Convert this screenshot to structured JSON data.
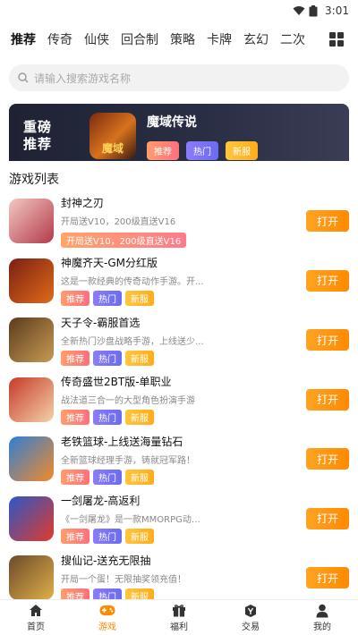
{
  "status": {
    "time": "3:01"
  },
  "tabs": [
    "推荐",
    "传奇",
    "仙侠",
    "回合制",
    "策略",
    "卡牌",
    "玄幻",
    "二次"
  ],
  "search": {
    "placeholder": "请输入搜索游戏名称"
  },
  "banner": {
    "tagline": "重磅\n推荐",
    "game_name": "魔域传说",
    "icon_text": "魔域",
    "badges": [
      "推荐",
      "热门",
      "新服"
    ]
  },
  "list": {
    "title": "游戏列表",
    "open_label": "打开",
    "games": [
      {
        "name": "封神之刃",
        "desc": "开局送V10，200级直送V16",
        "promo": "开局送V10，200级直送V16",
        "badges": [],
        "color1": "#f3c8c2",
        "color2": "#b23a48"
      },
      {
        "name": "神魔齐天-GM分红版",
        "desc": "这是一款经典的传奇动作手游。开...",
        "badges": [
          "推荐",
          "热门",
          "新服"
        ],
        "color1": "#7a1f12",
        "color2": "#e06a1a"
      },
      {
        "name": "天子令-霸服首选",
        "desc": "全新热门沙盘战略手游，上线送少...",
        "badges": [
          "推荐",
          "热门",
          "新服"
        ],
        "color1": "#5a3b1e",
        "color2": "#c89a52"
      },
      {
        "name": "传奇盛世2BT版-单职业",
        "desc": "战法道三合一的大型角色扮演手游",
        "badges": [
          "推荐",
          "热门",
          "新服"
        ],
        "color1": "#c83a2a",
        "color2": "#f2d2a8"
      },
      {
        "name": "老铁篮球-上线送海量钻石",
        "desc": "全新篮球经理手游，铸就冠军路！",
        "badges": [
          "推荐",
          "热门",
          "新服"
        ],
        "color1": "#2f7fd6",
        "color2": "#f28a2a"
      },
      {
        "name": "一剑屠龙-高返利",
        "desc": "《一剑屠龙》是一款MMORPG动作...",
        "badges": [
          "推荐",
          "热门",
          "新服"
        ],
        "color1": "#2a58c8",
        "color2": "#e23a2a"
      },
      {
        "name": "搜仙记-送充无限抽",
        "desc": "开局一个蛋！无限抽奖领充值！",
        "badges": [
          "推荐",
          "热门",
          "新服"
        ],
        "color1": "#6b4a2a",
        "color2": "#e0b04a"
      }
    ]
  },
  "nav": [
    {
      "label": "首页",
      "icon": "home-icon"
    },
    {
      "label": "游戏",
      "icon": "gamepad-icon",
      "active": true
    },
    {
      "label": "福利",
      "icon": "gift-icon"
    },
    {
      "label": "交易",
      "icon": "trade-icon"
    },
    {
      "label": "我的",
      "icon": "user-icon"
    }
  ],
  "colors": {
    "accent": "#ff8a00",
    "rec": "#ff7d76",
    "hot": "#7a74f5",
    "new": "#ffb828"
  }
}
